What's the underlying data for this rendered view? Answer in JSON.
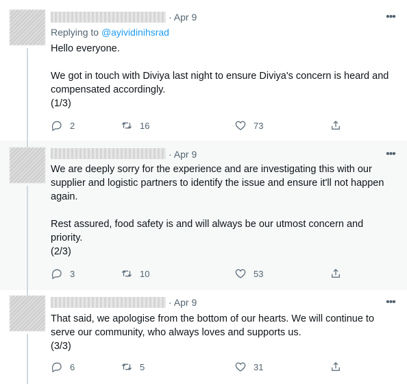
{
  "tweets": [
    {
      "date": "· Apr 9",
      "more": "•••",
      "replying_prefix": "Replying to ",
      "replying_handle": "@ayividinihsrad",
      "text": "Hello everyone.\n\nWe got in touch with Diviya last night to ensure Diviya's concern is heard and compensated accordingly.\n(1/3)",
      "replies": "2",
      "retweets": "16",
      "likes": "73"
    },
    {
      "date": "· Apr 9",
      "more": "•••",
      "text": "We are deeply sorry for the experience and are investigating this with our supplier and logistic partners to identify the issue and ensure it'll not happen again.\n\nRest assured, food safety is and will always be our utmost concern and priority.\n(2/3)",
      "replies": "3",
      "retweets": "10",
      "likes": "53"
    },
    {
      "date": "· Apr 9",
      "more": "•••",
      "text": "That said, we apologise from the bottom of our hearts. We will continue to serve our community, who always loves and supports us.\n(3/3)",
      "replies": "6",
      "retweets": "5",
      "likes": "31"
    }
  ],
  "icons": {
    "reply": "reply-icon",
    "retweet": "retweet-icon",
    "like": "heart-icon",
    "share": "share-icon",
    "more": "more-icon"
  },
  "colors": {
    "link": "#1d9bf0",
    "secondary_text": "#536471",
    "highlight_bg": "#f7f9f9"
  }
}
